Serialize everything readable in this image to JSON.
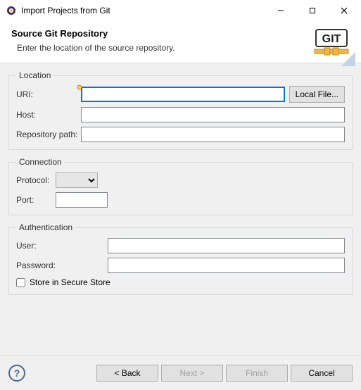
{
  "window": {
    "title": "Import Projects from Git"
  },
  "header": {
    "title": "Source Git Repository",
    "subtitle": "Enter the location of the source repository.",
    "logo_text": "GIT"
  },
  "location": {
    "legend": "Location",
    "uri_label": "URI:",
    "uri_value": "",
    "local_file_label": "Local File...",
    "host_label": "Host:",
    "host_value": "",
    "repo_label": "Repository path:",
    "repo_value": ""
  },
  "connection": {
    "legend": "Connection",
    "protocol_label": "Protocol:",
    "protocol_value": "",
    "port_label": "Port:",
    "port_value": ""
  },
  "authentication": {
    "legend": "Authentication",
    "user_label": "User:",
    "user_value": "",
    "password_label": "Password:",
    "password_value": "",
    "store_label": "Store in Secure Store",
    "store_checked": false
  },
  "buttons": {
    "back": "< Back",
    "next": "Next >",
    "finish": "Finish",
    "cancel": "Cancel"
  }
}
